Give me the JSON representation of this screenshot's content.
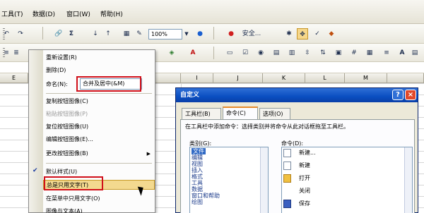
{
  "menubar": {
    "items": [
      "工具(T)",
      "数据(D)",
      "窗口(W)",
      "帮助(H)"
    ]
  },
  "toolbar1": {
    "zoom": "100%",
    "security_label": "安全..."
  },
  "toolbar2": {
    "font_label": "A"
  },
  "sheet": {
    "columns": [
      "E",
      "I",
      "J",
      "K",
      "L",
      "M"
    ]
  },
  "context_menu": {
    "items": [
      {
        "label": "重新设置(R)"
      },
      {
        "label": "删除(D)"
      },
      {
        "label": "命名(N):",
        "name_value": "合并及居中(&M)"
      },
      {
        "label": "复制按钮图像(C)"
      },
      {
        "label": "粘贴按钮图像(P)"
      },
      {
        "label": "复位按钮图像(U)"
      },
      {
        "label": "编辑按钮图像(E)..."
      },
      {
        "label": "更改按钮图像(B)"
      },
      {
        "label": "默认样式(U)"
      },
      {
        "label": "总是只用文字(T)"
      },
      {
        "label": "在菜单中只用文字(O)"
      },
      {
        "label": "图像与文本(A)"
      }
    ]
  },
  "dialog": {
    "title": "自定义",
    "help": "?",
    "close": "×",
    "tabs": [
      "工具栏(B)",
      "命令(C)",
      "选项(O)"
    ],
    "description": "在工具栏中添加命令：选择类别并将命令从此对话框拖至工具栏。",
    "categories_label": "类别(G):",
    "commands_label": "命令(D):",
    "categories": [
      "文件",
      "编辑",
      "视图",
      "插入",
      "格式",
      "工具",
      "数据",
      "窗口和帮助",
      "绘图"
    ],
    "commands": [
      "新建...",
      "新建",
      "打开",
      "关闭",
      "保存"
    ]
  },
  "colors": {
    "title_blue": "#0a4ec1",
    "highlight_red": "#d0101a",
    "menu_highlight": "#f3d98f"
  }
}
